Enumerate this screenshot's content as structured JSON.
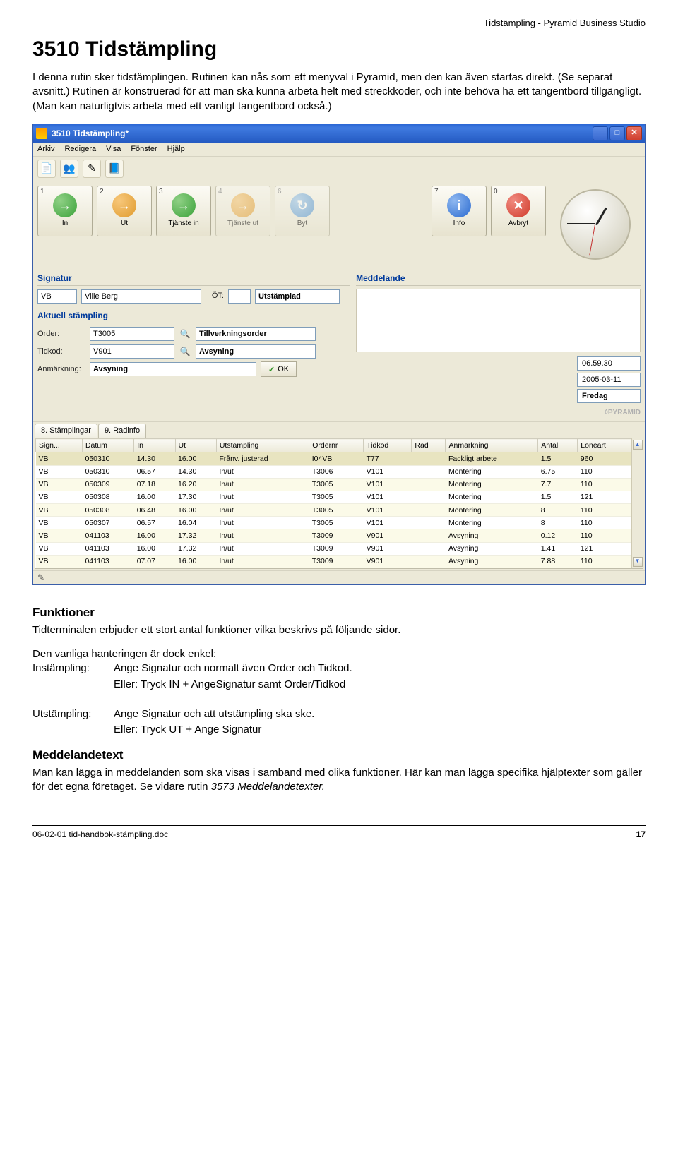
{
  "doc": {
    "header_right": "Tidstämpling - Pyramid Business Studio",
    "h1": "3510 Tidstämpling",
    "intro": "I denna rutin sker tidstämplingen. Rutinen kan nås som ett menyval i Pyramid, men den kan även startas direkt. (Se separat avsnitt.) Rutinen är konstruerad för att man ska kunna arbeta helt med streckkoder, och inte behöva ha ett tangentbord tillgängligt. (Man kan naturligtvis arbeta med ett vanligt tangentbord också.)",
    "functions_h": "Funktioner",
    "functions_p": "Tidterminalen erbjuder ett stort antal funktioner vilka beskrivs på följande sidor.",
    "easy_h": "Den vanliga hanteringen är dock enkel:",
    "instamp_lbl": "Instämpling:",
    "instamp_txt1": "Ange Signatur och normalt även Order och Tidkod.",
    "instamp_txt2": "Eller: Tryck IN  + AngeSignatur samt Order/Tidkod",
    "utstamp_lbl": "Utstämpling:",
    "utstamp_txt1": "Ange Signatur och att utstämpling ska ske.",
    "utstamp_txt2": "Eller: Tryck UT + Ange Signatur",
    "msg_h": "Meddelandetext",
    "msg_p": "Man kan lägga in meddelanden som ska visas i samband med olika funktioner. Här kan man lägga specifika hjälptexter som gäller för det egna företaget. Se vidare rutin ",
    "msg_ref": "3573 Meddelandetexter.",
    "footer_left": "06-02-01 tid-handbok-stämpling.doc",
    "footer_right": "17"
  },
  "app": {
    "title": "3510 Tidstämpling*",
    "menu": {
      "arkiv": "Arkiv",
      "redigera": "Redigera",
      "visa": "Visa",
      "fonster": "Fönster",
      "hjalp": "Hjälp"
    },
    "actions": {
      "in": {
        "num": "1",
        "label": "In",
        "glyph": "→"
      },
      "ut": {
        "num": "2",
        "label": "Ut",
        "glyph": "→"
      },
      "tin": {
        "num": "3",
        "label": "Tjänste in",
        "glyph": "→"
      },
      "tut": {
        "num": "4",
        "label": "Tjänste ut",
        "glyph": "→"
      },
      "byt": {
        "num": "6",
        "label": "Byt",
        "glyph": "↻"
      },
      "info": {
        "num": "7",
        "label": "Info",
        "glyph": "i"
      },
      "avbryt": {
        "num": "0",
        "label": "Avbryt",
        "glyph": "✕"
      }
    },
    "signatur_h": "Signatur",
    "sig_code": "VB",
    "sig_name": "Ville Berg",
    "ot_label": "ÖT:",
    "ot_val": "",
    "status": "Utstämplad",
    "meddelande_h": "Meddelande",
    "aktuell_h": "Aktuell stämpling",
    "order_lbl": "Order:",
    "order_val": "T3005",
    "order_desc": "Tillverkningsorder",
    "tidkod_lbl": "Tidkod:",
    "tidkod_val": "V901",
    "tidkod_desc": "Avsyning",
    "anm_lbl": "Anmärkning:",
    "anm_val": "Avsyning",
    "ok_label": "OK",
    "time": "06.59.30",
    "date": "2005-03-11",
    "day": "Fredag",
    "brand": "◊PYRAMID",
    "tabs": {
      "t1": "8. Stämplingar",
      "t2": "9. Radinfo"
    },
    "grid": {
      "cols": [
        "Sign...",
        "Datum",
        "In",
        "Ut",
        "Utstämpling",
        "Ordernr",
        "Tidkod",
        "Rad",
        "Anmärkning",
        "Antal",
        "Löneart"
      ],
      "rows": [
        [
          "VB",
          "050310",
          "14.30",
          "16.00",
          "Frånv. justerad",
          "I04VB",
          "T77",
          "",
          "Fackligt arbete",
          "1.5",
          "960"
        ],
        [
          "VB",
          "050310",
          "06.57",
          "14.30",
          "In/ut",
          "T3006",
          "V101",
          "",
          "Montering",
          "6.75",
          "110"
        ],
        [
          "VB",
          "050309",
          "07.18",
          "16.20",
          "In/ut",
          "T3005",
          "V101",
          "",
          "Montering",
          "7.7",
          "110"
        ],
        [
          "VB",
          "050308",
          "16.00",
          "17.30",
          "In/ut",
          "T3005",
          "V101",
          "",
          "Montering",
          "1.5",
          "121"
        ],
        [
          "VB",
          "050308",
          "06.48",
          "16.00",
          "In/ut",
          "T3005",
          "V101",
          "",
          "Montering",
          "8",
          "110"
        ],
        [
          "VB",
          "050307",
          "06.57",
          "16.04",
          "In/ut",
          "T3005",
          "V101",
          "",
          "Montering",
          "8",
          "110"
        ],
        [
          "VB",
          "041103",
          "16.00",
          "17.32",
          "In/ut",
          "T3009",
          "V901",
          "",
          "Avsyning",
          "0.12",
          "110"
        ],
        [
          "VB",
          "041103",
          "16.00",
          "17.32",
          "In/ut",
          "T3009",
          "V901",
          "",
          "Avsyning",
          "1.41",
          "121"
        ],
        [
          "VB",
          "041103",
          "07.07",
          "16.00",
          "In/ut",
          "T3009",
          "V901",
          "",
          "Avsyning",
          "7.88",
          "110"
        ]
      ]
    }
  }
}
